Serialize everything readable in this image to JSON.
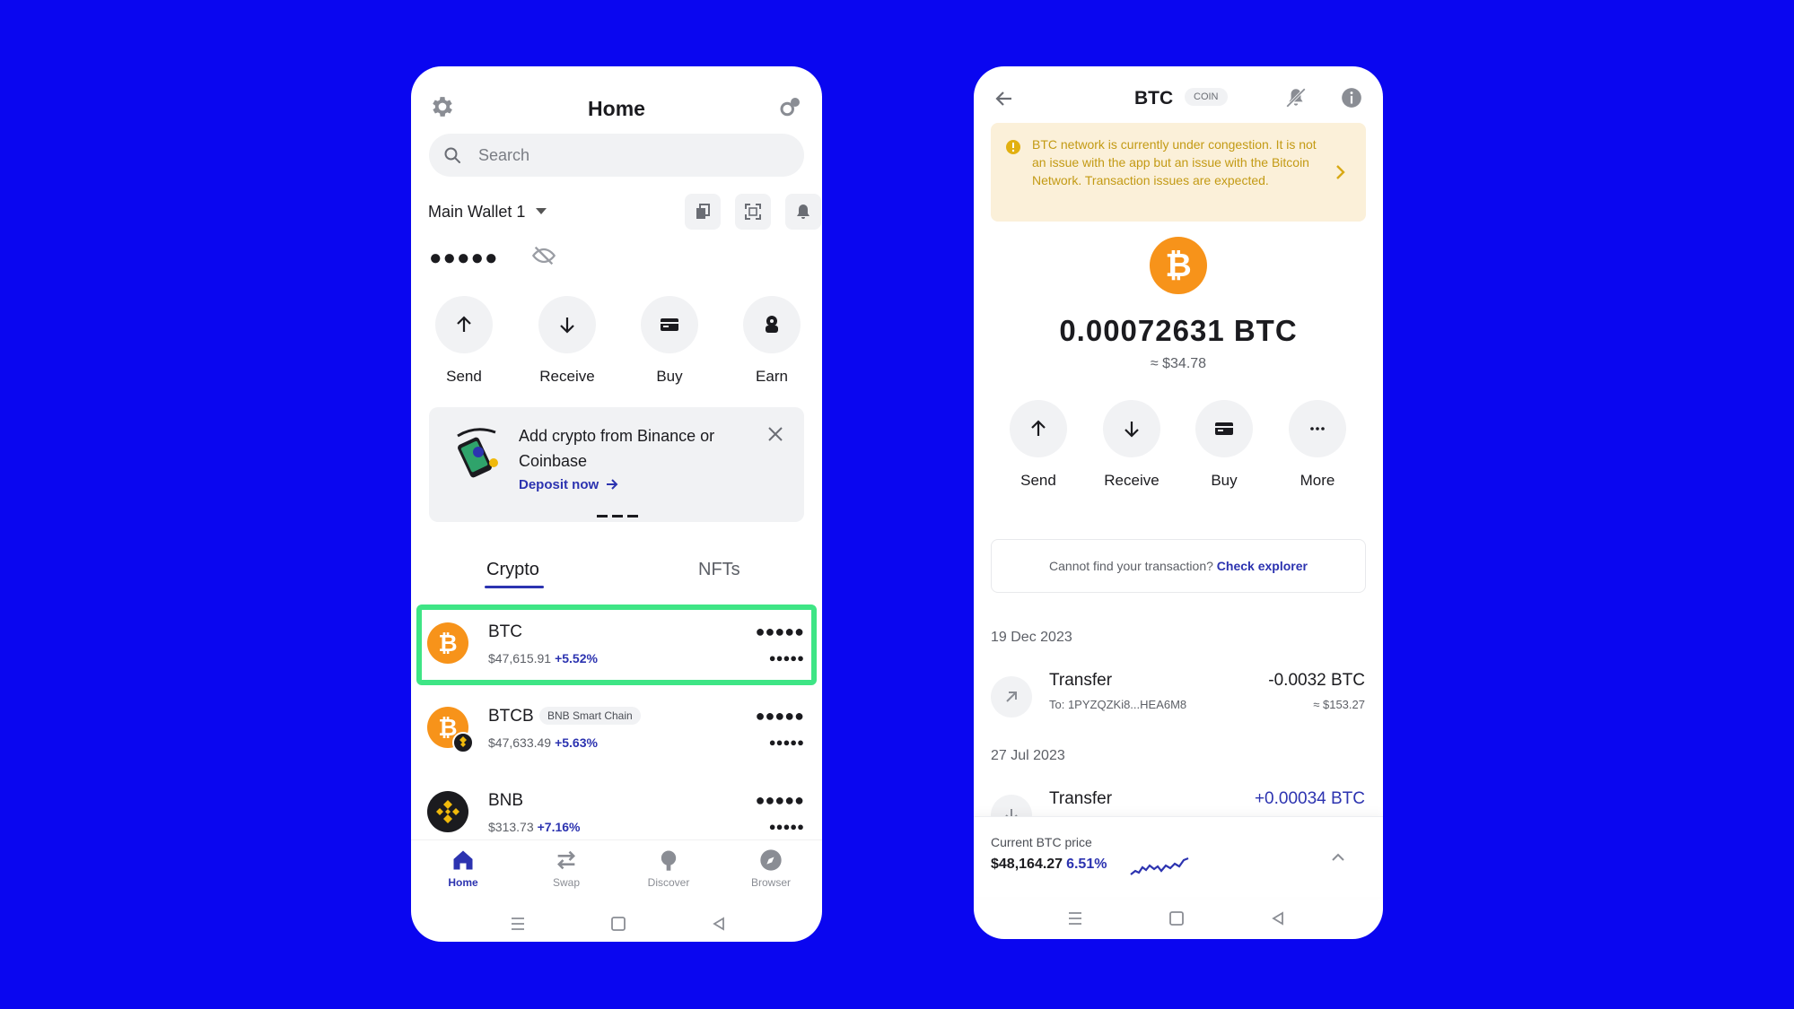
{
  "colors": {
    "background": "#0a06f0",
    "accent": "#2c33b0",
    "highlight": "#3ee585",
    "btc_orange": "#f7931a",
    "alert_bg": "#fbf0d9",
    "alert_text": "#c39a14"
  },
  "home": {
    "title": "Home",
    "search_placeholder": "Search",
    "wallet_name": "Main Wallet 1",
    "balance_hidden": "●●●●●",
    "actions": [
      {
        "label": "Send",
        "icon": "arrow-up-icon"
      },
      {
        "label": "Receive",
        "icon": "arrow-down-icon"
      },
      {
        "label": "Buy",
        "icon": "card-icon"
      },
      {
        "label": "Earn",
        "icon": "earn-icon"
      }
    ],
    "promo": {
      "title": "Add crypto from Binance or Coinbase",
      "link": "Deposit now"
    },
    "tabs": [
      "Crypto",
      "NFTs"
    ],
    "active_tab": "Crypto",
    "assets": [
      {
        "name": "BTC",
        "price": "$47,615.91",
        "change": "+5.52%",
        "balance": "●●●●●",
        "fiat": "●●●●●",
        "highlighted": true
      },
      {
        "name": "BTCB",
        "chain": "BNB Smart Chain",
        "price": "$47,633.49",
        "change": "+5.63%",
        "balance": "●●●●●",
        "fiat": "●●●●●"
      },
      {
        "name": "BNB",
        "price": "$313.73",
        "change": "+7.16%",
        "balance": "●●●●●",
        "fiat": "●●●●●"
      }
    ],
    "nav": [
      {
        "label": "Home",
        "icon": "home-icon",
        "active": true
      },
      {
        "label": "Swap",
        "icon": "swap-icon"
      },
      {
        "label": "Discover",
        "icon": "discover-icon"
      },
      {
        "label": "Browser",
        "icon": "browser-icon"
      }
    ]
  },
  "btc": {
    "title": "BTC",
    "badge": "COIN",
    "alert": "BTC network is currently under congestion. It is not an issue with the app but an issue with the Bitcoin Network. Transaction issues are expected.",
    "amount": "0.00072631 BTC",
    "fiat": "≈ $34.78",
    "actions": [
      {
        "label": "Send",
        "icon": "arrow-up-icon"
      },
      {
        "label": "Receive",
        "icon": "arrow-down-icon"
      },
      {
        "label": "Buy",
        "icon": "card-icon"
      },
      {
        "label": "More",
        "icon": "more-icon"
      }
    ],
    "explorer_text": "Cannot find your transaction?",
    "explorer_link": "Check explorer",
    "transactions": [
      {
        "date": "19 Dec 2023",
        "type": "Transfer",
        "sub": "To: 1PYZQZKi8...HEA6M8",
        "amount": "-0.0032 BTC",
        "fiat": "≈ $153.27",
        "direction": "out"
      },
      {
        "date": "27 Jul 2023",
        "type": "Transfer",
        "sub": "",
        "amount": "+0.00034 BTC",
        "fiat": "",
        "direction": "in"
      }
    ],
    "price_label": "Current BTC price",
    "price_value": "$48,164.27",
    "price_change": "6.51%"
  }
}
